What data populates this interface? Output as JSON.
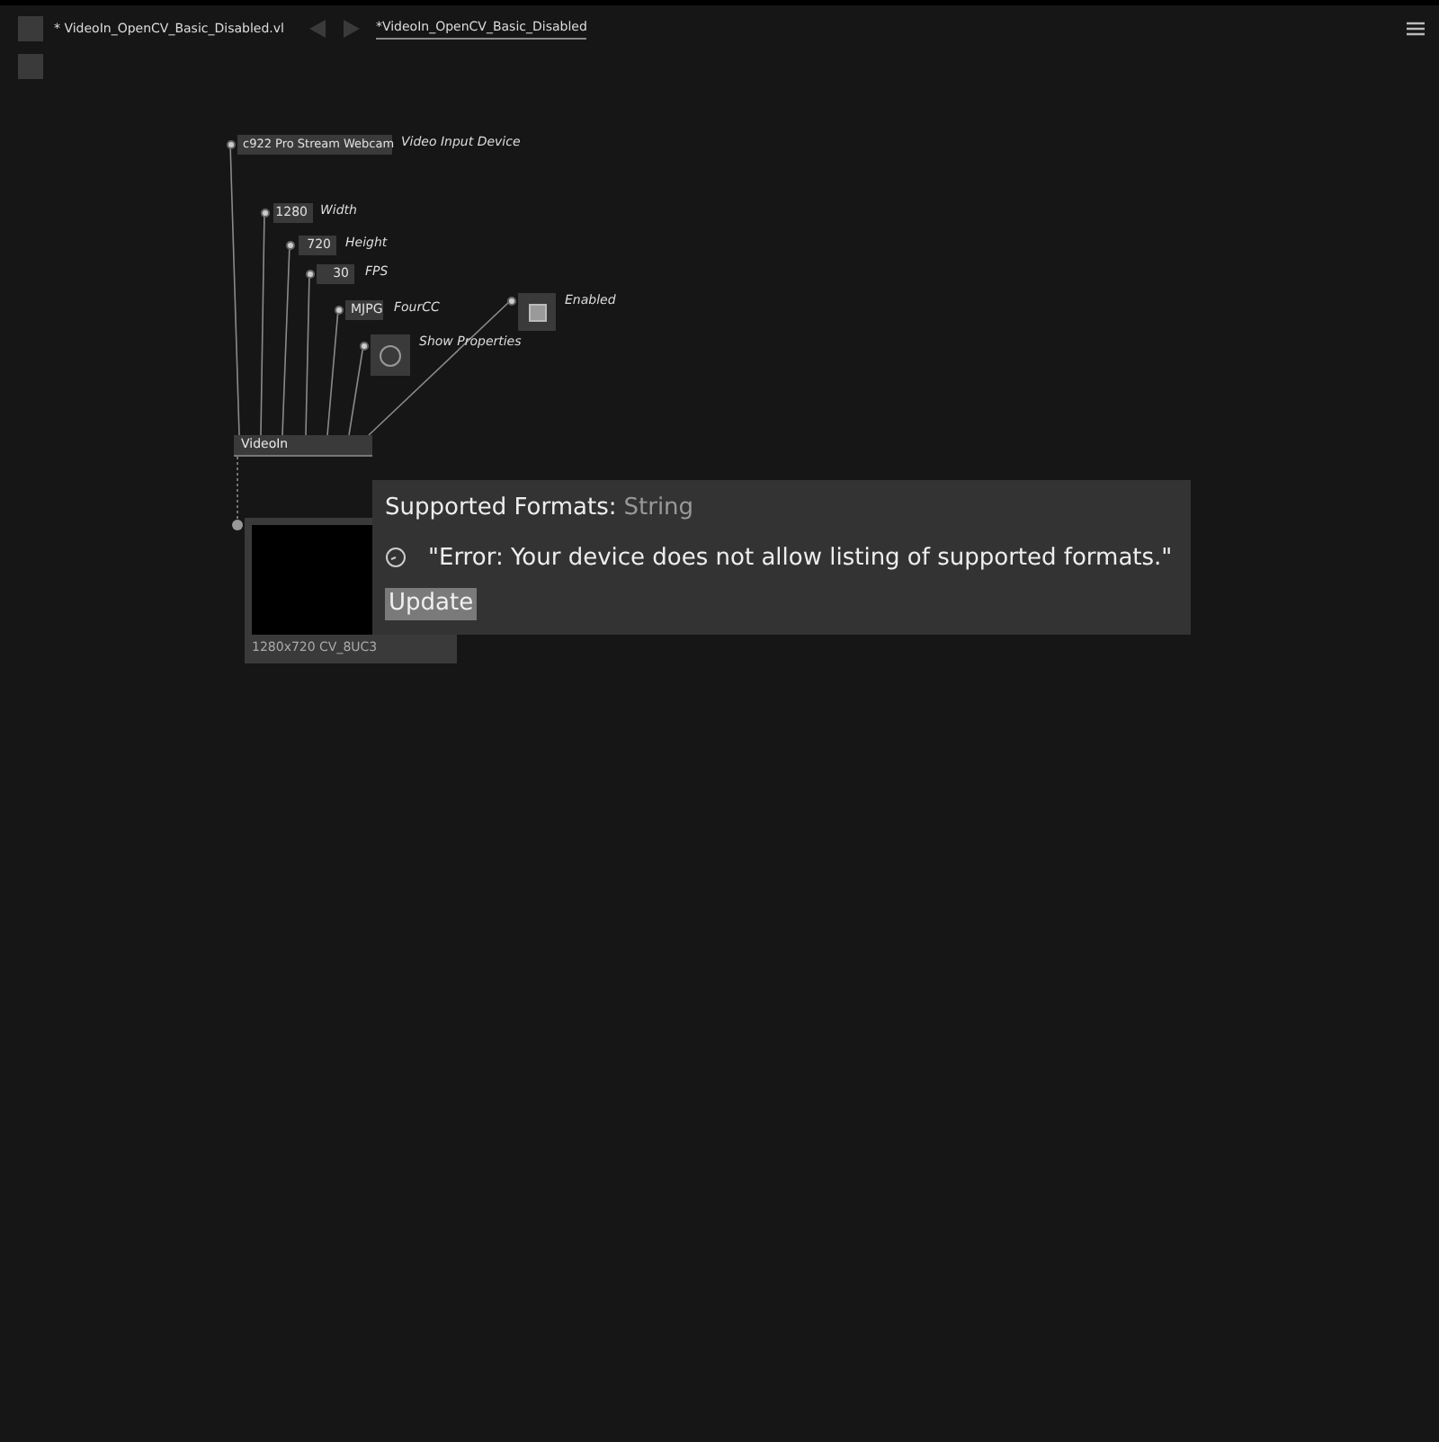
{
  "document_tab": {
    "title": "* VideoIn_OpenCV_Basic_Disabled.vl"
  },
  "breadcrumb": "*VideoIn_OpenCV_Basic_Disabled",
  "inputs": [
    {
      "kind": "dropdown",
      "value": "c922 Pro Stream Webcam",
      "label": "Video Input Device"
    },
    {
      "kind": "number",
      "value": "1280",
      "label": "Width"
    },
    {
      "kind": "number",
      "value": "720",
      "label": "Height"
    },
    {
      "kind": "number",
      "value": "30",
      "label": "FPS"
    },
    {
      "kind": "text",
      "value": "MJPG",
      "label": "FourCC"
    },
    {
      "kind": "toggle",
      "checked": true,
      "label": "Enabled"
    },
    {
      "kind": "bang",
      "label": "Show Properties"
    }
  ],
  "node": {
    "title": "VideoIn"
  },
  "preview": {
    "caption": "1280x720 CV_8UC3"
  },
  "tooltip": {
    "title": "Supported Formats:",
    "type": "String",
    "message": "\"Error: Your device does not allow listing of supported formats.\"",
    "button": "Update"
  }
}
